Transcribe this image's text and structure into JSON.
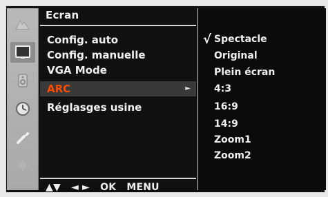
{
  "menu": {
    "title": "Ecran",
    "items": [
      {
        "label": "Config. auto"
      },
      {
        "label": "Config. manuelle"
      },
      {
        "label": "VGA Mode"
      },
      {
        "label": "ARC",
        "selected": true
      },
      {
        "label": "Réglasges usine"
      }
    ],
    "selected_arrow": "►",
    "nav": {
      "ud": "▲▼",
      "lr": "◄ ►",
      "ok": "OK",
      "menu": "MENU"
    }
  },
  "submenu": {
    "check": "√",
    "options": [
      "Spectacle",
      "Original",
      "Plein écran",
      "4:3",
      "16:9",
      "14:9",
      "Zoom1",
      "Zoom2"
    ],
    "selected_index": 0
  },
  "rail": {
    "icons": [
      "picture-icon",
      "screen-icon",
      "audio-icon",
      "time-icon",
      "tools-icon",
      "settings-icon"
    ],
    "active_index": 1
  },
  "colors": {
    "highlight_text": "#ff4b00"
  }
}
